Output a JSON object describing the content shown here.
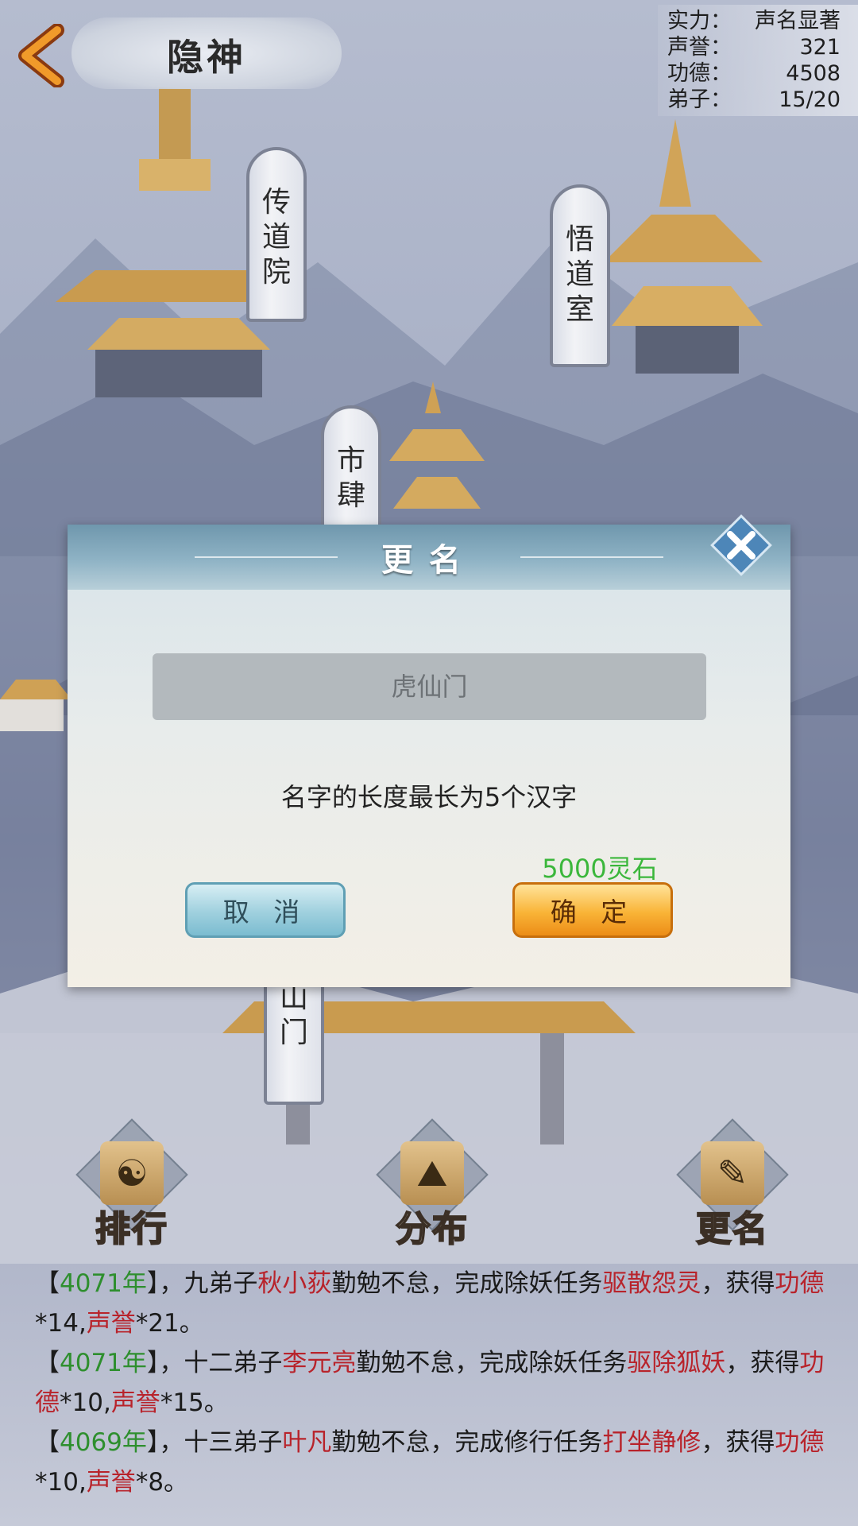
{
  "header": {
    "title": "隐神"
  },
  "stats": [
    {
      "label": "实力：",
      "value": "声名显著"
    },
    {
      "label": "声誉：",
      "value": "321"
    },
    {
      "label": "功德：",
      "value": "4508"
    },
    {
      "label": "弟子：",
      "value": "15/20"
    }
  ],
  "buildings": [
    {
      "name": [
        "传",
        "道",
        "院"
      ]
    },
    {
      "name": [
        "悟",
        "道",
        "室"
      ]
    },
    {
      "name": [
        "市",
        "肆"
      ]
    },
    {
      "name": [
        "山",
        "门"
      ]
    }
  ],
  "dialog": {
    "title": "更名",
    "input_value": "虎仙门",
    "hint": "名字的长度最长为5个汉字",
    "cost": "5000灵石",
    "cancel_label": "取 消",
    "confirm_label": "确 定"
  },
  "menu": [
    {
      "label": "排行",
      "icon": "yin-yang-icon"
    },
    {
      "label": "分布",
      "icon": "map-icon"
    },
    {
      "label": "更名",
      "icon": "brush-icon"
    }
  ],
  "log": [
    {
      "open": "【",
      "year": "4071年",
      "close": "】",
      "t1": "，九弟子",
      "disciple": "秋小荻",
      "t2": "勤勉不怠，完成除妖任务",
      "task": "驱散怨灵",
      "t3": "，获得",
      "r1": "功德",
      "v1": "*14,",
      "r2": "声誉",
      "v2": "*21。"
    },
    {
      "open": "【",
      "year": "4071年",
      "close": "】",
      "t1": "，十二弟子",
      "disciple": "李元亮",
      "t2": "勤勉不怠，完成除妖任务",
      "task": "驱除狐妖",
      "t3": "，获得",
      "r1": "功德",
      "v1": "*10,",
      "r2": "声誉",
      "v2": "*15。"
    },
    {
      "open": "【",
      "year": "4069年",
      "close": "】",
      "t1": "，十三弟子",
      "disciple": "叶凡",
      "t2": "勤勉不怠，完成修行任务",
      "task": "打坐静修",
      "t3": "，获得",
      "r1": "功德",
      "v1": "*10,",
      "r2": "声誉",
      "v2": "*8。"
    }
  ]
}
